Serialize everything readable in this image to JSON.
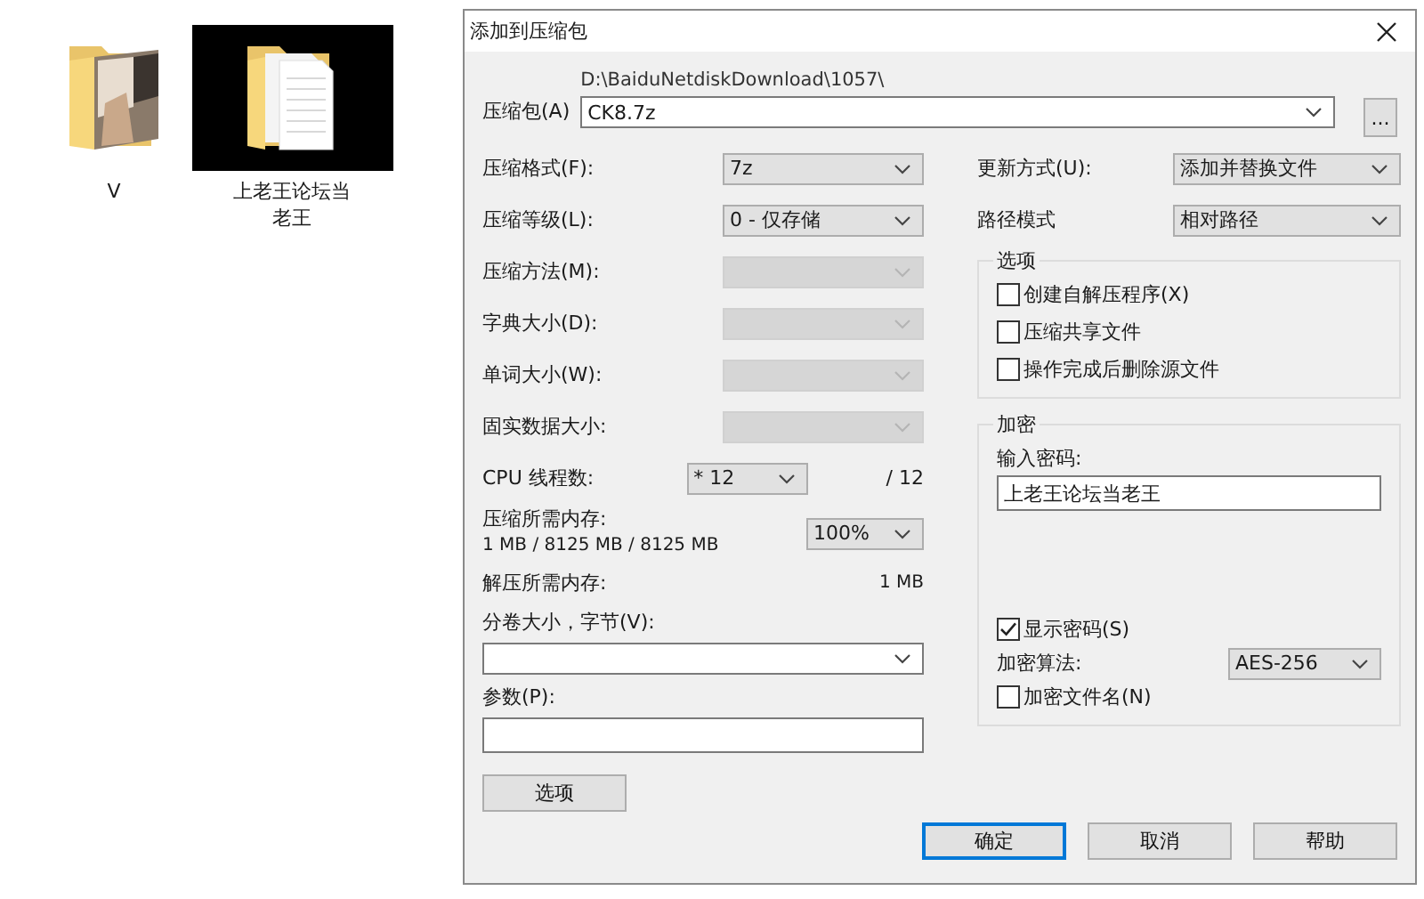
{
  "desktop": {
    "items": [
      {
        "label": "V",
        "kind": "photo",
        "selected": false
      },
      {
        "label": "上老王论坛当老王",
        "kind": "documents",
        "selected": true
      }
    ]
  },
  "dialog": {
    "title": "添加到压缩包",
    "archive": {
      "label": "压缩包(A)",
      "path": "D:\\BaiduNetdiskDownload\\1057\\",
      "value": "CK8.7z",
      "browse": "..."
    },
    "left_fields": [
      {
        "kind": "select",
        "label": "压缩格式(F):",
        "value": "7z",
        "disabled": false
      },
      {
        "kind": "select",
        "label": "压缩等级(L):",
        "value": "0 - 仅存储",
        "disabled": false
      },
      {
        "kind": "select",
        "label": "压缩方法(M):",
        "disabled": true
      },
      {
        "kind": "select",
        "label": "字典大小(D):",
        "disabled": true
      },
      {
        "kind": "select",
        "label": "单词大小(W):",
        "disabled": true
      },
      {
        "kind": "select",
        "label": "固实数据大小:",
        "disabled": true
      },
      {
        "kind": "threads",
        "label": "CPU 线程数:",
        "value": "* 12",
        "note": "/ 12"
      },
      {
        "kind": "memory",
        "label": "压缩所需内存:",
        "detail": "1 MB / 8125 MB / 8125 MB",
        "value": "100%"
      },
      {
        "kind": "readout",
        "label": "解压所需内存:",
        "value": "1 MB"
      }
    ],
    "volume": {
      "label": "分卷大小，字节(V):"
    },
    "params": {
      "label": "参数(P):"
    },
    "options_button": "选项",
    "right_fields": [
      {
        "label": "更新方式(U):",
        "value": "添加并替换文件"
      },
      {
        "label": "路径模式",
        "value": "相对路径"
      }
    ],
    "options_group": {
      "title": "选项",
      "checkboxes": [
        {
          "label": "创建自解压程序(X)",
          "checked": false
        },
        {
          "label": "压缩共享文件",
          "checked": false
        },
        {
          "label": "操作完成后删除源文件",
          "checked": false
        }
      ]
    },
    "encryption": {
      "title": "加密",
      "password_label": "输入密码:",
      "password": "上老王论坛当老王",
      "show_password": {
        "label": "显示密码(S)",
        "checked": true
      },
      "method_label": "加密算法:",
      "method": "AES-256",
      "encrypt_names": {
        "label": "加密文件名(N)",
        "checked": false
      }
    },
    "buttons": [
      {
        "label": "确定",
        "default": true
      },
      {
        "label": "取消",
        "default": false
      },
      {
        "label": "帮助",
        "default": false
      }
    ]
  }
}
